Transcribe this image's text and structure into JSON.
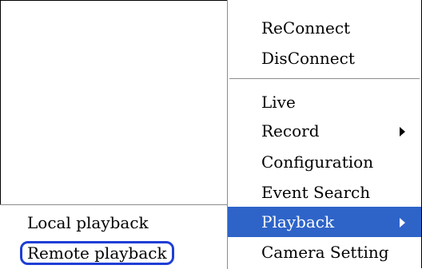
{
  "context_menu": {
    "items": [
      {
        "label": "ReConnect"
      },
      {
        "label": "DisConnect"
      },
      {
        "label": "Live"
      },
      {
        "label": "Record"
      },
      {
        "label": "Configuration"
      },
      {
        "label": "Event Search"
      },
      {
        "label": "Playback"
      },
      {
        "label": "Camera Setting"
      }
    ]
  },
  "playback_submenu": {
    "items": [
      {
        "label": "Local playback"
      },
      {
        "label": "Remote playback"
      }
    ]
  },
  "colors": {
    "selection_bg": "#2e64c8",
    "annotation_ring": "#1f3ed6"
  }
}
